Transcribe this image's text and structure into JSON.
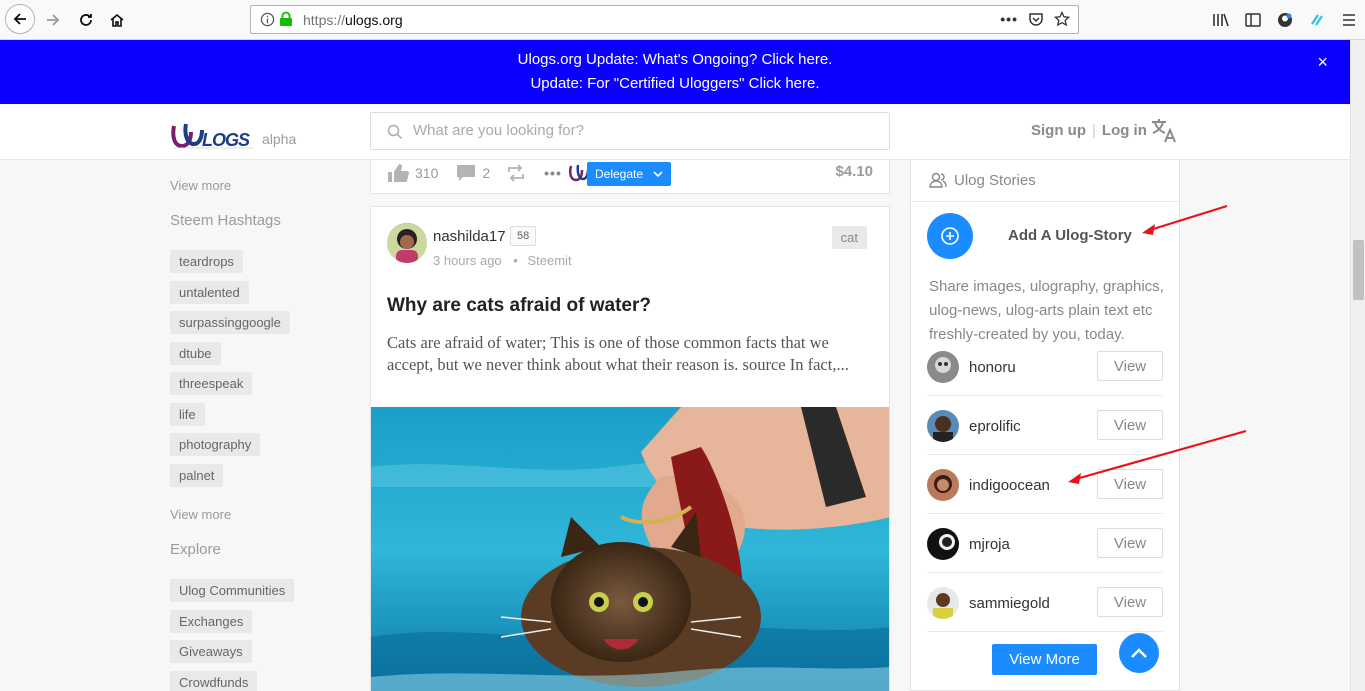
{
  "browser": {
    "url_scheme": "https://",
    "url_host": "ulogs.org"
  },
  "notice": {
    "line1": "Ulogs.org Update: What's Ongoing?  Click here.",
    "line2": "Update: For \"Certified Uloggers\"  Click here.",
    "close": "×"
  },
  "header": {
    "logo_text": "ULOGS",
    "logo_suffix": "alpha",
    "search_placeholder": "What are you looking for?",
    "signup": "Sign up",
    "separator": "|",
    "login": "Log in"
  },
  "left_sidebar": {
    "view_more_1": "View more",
    "hashtags_title": "Steem Hashtags",
    "hashtags": [
      "teardrops",
      "untalented",
      "surpassinggoogle",
      "dtube",
      "threespeak",
      "life",
      "photography",
      "palnet"
    ],
    "view_more_2": "View more",
    "explore_title": "Explore",
    "explore_items": [
      "Ulog Communities",
      "Exchanges",
      "Giveaways",
      "Crowdfunds"
    ]
  },
  "prev_post": {
    "votes": "310",
    "comments": "2",
    "more": "•••",
    "delegate": "Delegate",
    "payout": "$4.10"
  },
  "post": {
    "author": "nashilda17",
    "reputation": "58",
    "time": "3 hours ago",
    "dot": "•",
    "platform": "Steemit",
    "tag": "cat",
    "title": "Why are cats afraid of water?",
    "excerpt": "Cats are afraid of water; This is one of those common facts that we accept, but we never think about what their reason is. source In fact,..."
  },
  "stories": {
    "title": "Ulog Stories",
    "add_label": "Add A Ulog-Story",
    "description": "Share images, ulography, graphics, ulog-news, ulog-arts plain text etc freshly-created by you, today.",
    "items": [
      {
        "name": "honoru",
        "action": "View"
      },
      {
        "name": "eprolific",
        "action": "View"
      },
      {
        "name": "indigoocean",
        "action": "View"
      },
      {
        "name": "mjroja",
        "action": "View"
      },
      {
        "name": "sammiegold",
        "action": "View"
      }
    ],
    "view_more": "View More"
  },
  "colors": {
    "notice_bg": "#0b00ff",
    "accent": "#1a8cff",
    "annotation": "#e8141c"
  }
}
